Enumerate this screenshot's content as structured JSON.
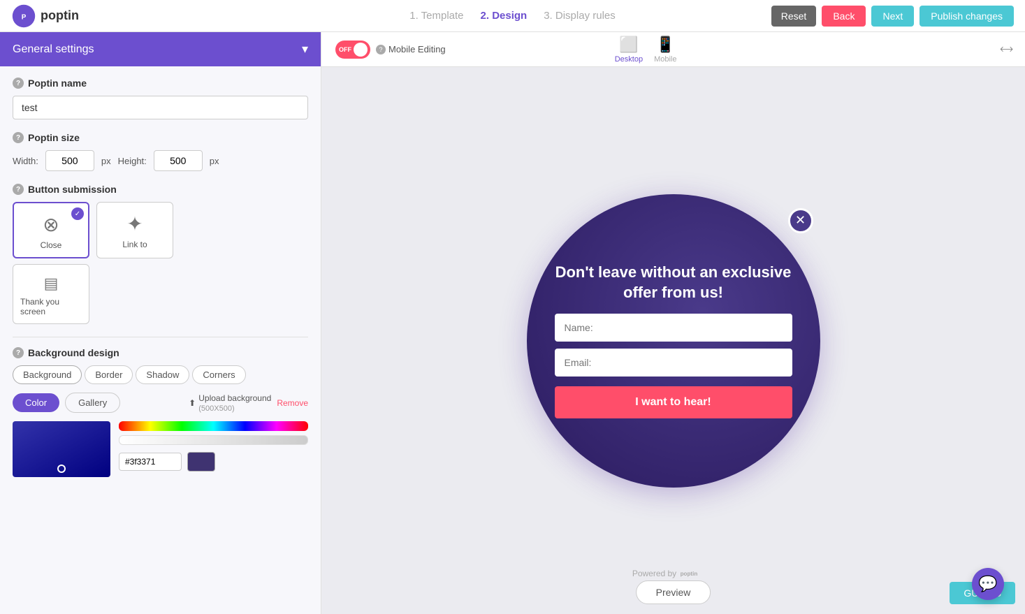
{
  "app": {
    "logo_text": "poptin"
  },
  "top_nav": {
    "steps": [
      {
        "label": "1. Template",
        "key": "template"
      },
      {
        "label": "2. Design",
        "key": "design"
      },
      {
        "label": "3. Display rules",
        "key": "display"
      }
    ],
    "active_step": "design",
    "reset_label": "Reset",
    "back_label": "Back",
    "next_label": "Next",
    "publish_label": "Publish changes"
  },
  "left_panel": {
    "section_title": "General settings",
    "poptin_name_label": "Poptin name",
    "poptin_name_value": "test",
    "poptin_size_label": "Poptin size",
    "width_label": "Width:",
    "width_value": "500",
    "height_label": "Height:",
    "height_value": "500",
    "unit": "px",
    "button_submission_label": "Button submission",
    "button_options": [
      {
        "label": "Close",
        "key": "close",
        "selected": true
      },
      {
        "label": "Link to",
        "key": "link"
      }
    ],
    "thank_you_label": "Thank you screen",
    "background_design_label": "Background design",
    "bg_tabs": [
      "Background",
      "Border",
      "Shadow",
      "Corners"
    ],
    "active_bg_tab": "Background",
    "color_label": "Color",
    "gallery_label": "Gallery",
    "upload_label": "Upload background",
    "upload_sublabel": "(500X500)",
    "remove_label": "Remove",
    "hex_value": "#3f3371"
  },
  "preview": {
    "toggle_label": "OFF",
    "mobile_editing_label": "Mobile Editing",
    "desktop_label": "Desktop",
    "mobile_label": "Mobile",
    "popup_title": "Don't leave without an exclusive offer from us!",
    "name_placeholder": "Name:",
    "email_placeholder": "Email:",
    "cta_label": "I want to hear!",
    "powered_by": "Powered by",
    "powered_brand": "poptin",
    "preview_btn": "Preview",
    "guides_btn": "GUIDES"
  }
}
